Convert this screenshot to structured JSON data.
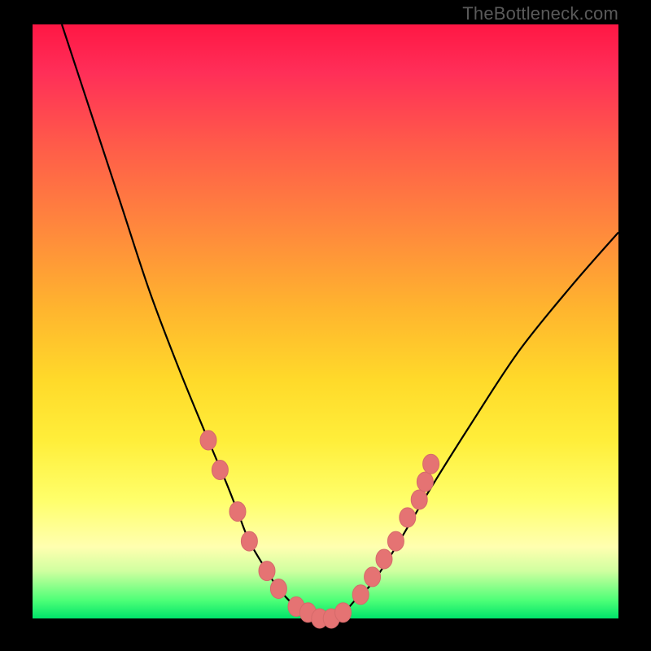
{
  "watermark": "TheBottleneck.com",
  "chart_data": {
    "type": "line",
    "title": "",
    "xlabel": "",
    "ylabel": "",
    "xlim": [
      0,
      100
    ],
    "ylim": [
      0,
      100
    ],
    "grid": false,
    "legend": false,
    "series": [
      {
        "name": "bottleneck-curve",
        "x": [
          5,
          10,
          15,
          20,
          25,
          30,
          33,
          35,
          37,
          40,
          42,
          45,
          48,
          50,
          53,
          55,
          58,
          62,
          68,
          75,
          83,
          92,
          100
        ],
        "y": [
          100,
          85,
          70,
          55,
          42,
          30,
          23,
          18,
          13,
          8,
          5,
          2,
          1,
          0,
          1,
          3,
          6,
          12,
          22,
          33,
          45,
          56,
          65
        ]
      }
    ],
    "markers": [
      {
        "name": "left-marker-1",
        "x": 30,
        "y": 30
      },
      {
        "name": "left-marker-2",
        "x": 32,
        "y": 25
      },
      {
        "name": "left-marker-3",
        "x": 35,
        "y": 18
      },
      {
        "name": "left-marker-4",
        "x": 37,
        "y": 13
      },
      {
        "name": "left-marker-5",
        "x": 40,
        "y": 8
      },
      {
        "name": "left-marker-6",
        "x": 42,
        "y": 5
      },
      {
        "name": "bottom-marker-1",
        "x": 45,
        "y": 2
      },
      {
        "name": "bottom-marker-2",
        "x": 47,
        "y": 1
      },
      {
        "name": "bottom-marker-3",
        "x": 49,
        "y": 0
      },
      {
        "name": "bottom-marker-4",
        "x": 51,
        "y": 0
      },
      {
        "name": "bottom-marker-5",
        "x": 53,
        "y": 1
      },
      {
        "name": "right-marker-1",
        "x": 56,
        "y": 4
      },
      {
        "name": "right-marker-2",
        "x": 58,
        "y": 7
      },
      {
        "name": "right-marker-3",
        "x": 60,
        "y": 10
      },
      {
        "name": "right-marker-4",
        "x": 62,
        "y": 13
      },
      {
        "name": "right-marker-5",
        "x": 64,
        "y": 17
      },
      {
        "name": "right-marker-6",
        "x": 66,
        "y": 20
      },
      {
        "name": "right-marker-7",
        "x": 67,
        "y": 23
      },
      {
        "name": "right-marker-8",
        "x": 68,
        "y": 26
      }
    ],
    "colors": {
      "curve": "#000000",
      "marker_fill": "#e57373",
      "marker_stroke": "#d56a6a"
    }
  }
}
